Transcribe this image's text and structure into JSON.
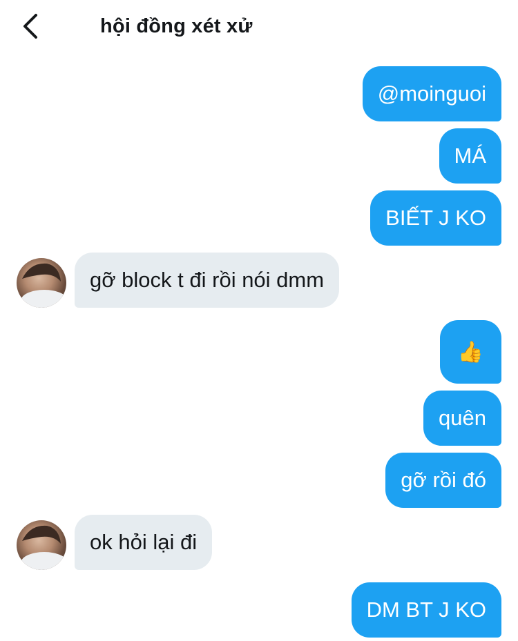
{
  "header": {
    "title": "hội đồng xét xử"
  },
  "messages": [
    {
      "side": "out",
      "text": "@moinguoi"
    },
    {
      "side": "out",
      "text": "MÁ"
    },
    {
      "side": "out",
      "text": "BIẾT J KO"
    },
    {
      "side": "in",
      "text": "gỡ block t đi rồi nói dmm"
    },
    {
      "side": "out",
      "text": "👍"
    },
    {
      "side": "out",
      "text": "quên"
    },
    {
      "side": "out",
      "text": "gỡ rồi đó"
    },
    {
      "side": "in",
      "text": "ok hỏi lại đi"
    },
    {
      "side": "out",
      "text": "DM BT J KO"
    }
  ],
  "colors": {
    "outgoing_bubble": "#1da1f2",
    "incoming_bubble": "#e6ecf0",
    "text_dark": "#14171a"
  },
  "icons": {
    "back": "chevron-left-icon",
    "avatar": "user-avatar"
  }
}
